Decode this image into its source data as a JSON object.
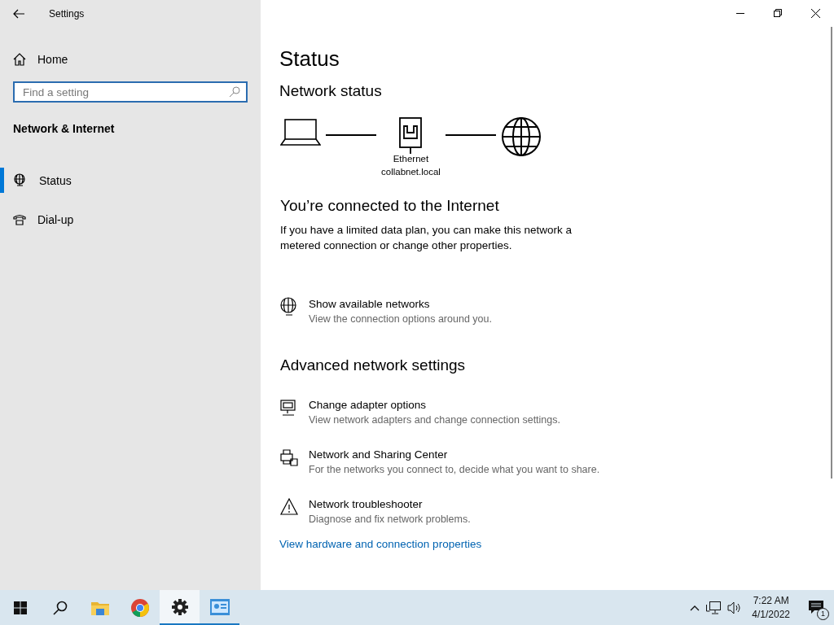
{
  "window": {
    "title": "Settings"
  },
  "sidebar": {
    "home": "Home",
    "search": {
      "placeholder": "Find a setting"
    },
    "section": "Network & Internet",
    "items": [
      {
        "label": "Status",
        "kind": "status",
        "selected": true
      },
      {
        "label": "Dial-up",
        "kind": "dialup",
        "selected": false
      }
    ]
  },
  "main": {
    "title": "Status",
    "network_status": {
      "heading": "Network status",
      "adapter": "Ethernet",
      "network": "collabnet.local"
    },
    "connection": {
      "heading": "You’re connected to the Internet",
      "text": "If you have a limited data plan, you can make this network a metered connection or change other properties."
    },
    "options": [
      {
        "kind": "networks",
        "title": "Show available networks",
        "description": "View the connection options around you."
      }
    ],
    "advanced": {
      "heading": "Advanced network settings",
      "items": [
        {
          "kind": "adapter",
          "title": "Change adapter options",
          "description": "View network adapters and change connection settings."
        },
        {
          "kind": "sharing",
          "title": "Network and Sharing Center",
          "description": "For the networks you connect to, decide what you want to share."
        },
        {
          "kind": "troubleshooter",
          "title": "Network troubleshooter",
          "description": "Diagnose and fix network problems."
        }
      ]
    },
    "link": "View hardware and connection properties"
  },
  "taskbar": {
    "apps": [
      {
        "kind": "start",
        "selected": false,
        "open": false
      },
      {
        "kind": "search",
        "selected": false,
        "open": false
      },
      {
        "kind": "folder",
        "selected": false,
        "open": false
      },
      {
        "kind": "browser",
        "selected": false,
        "open": false
      },
      {
        "kind": "settings",
        "selected": true,
        "open": true
      },
      {
        "kind": "app",
        "selected": false,
        "open": true
      }
    ],
    "time": "7:22 AM",
    "date": "4/1/2022",
    "notifications": "1"
  }
}
